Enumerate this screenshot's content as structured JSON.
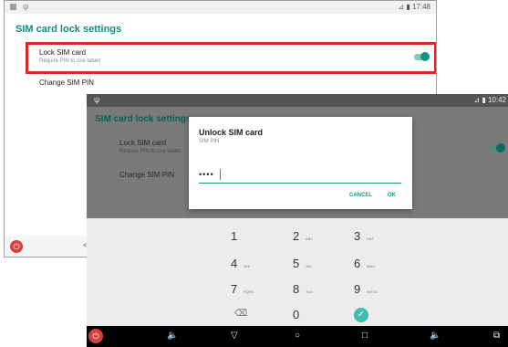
{
  "back_screen": {
    "status": {
      "usb_icon": "usb-icon",
      "time": "17:48",
      "right_icons": "⊿ ▮"
    },
    "title": "SIM card lock settings",
    "lock_sim": {
      "label": "Lock SIM card",
      "summary": "Require PIN to use tablet",
      "toggle_on": true
    },
    "change_pin": "Change SIM PIN",
    "highlight_color": "#e12627",
    "accent": "#0d8f80"
  },
  "front_screen": {
    "status": {
      "time": "10:42",
      "right_icons": "⊿ ▮"
    },
    "title": "SIM card lock settings",
    "lock_sim": {
      "label": "Lock SIM card",
      "summary": "Require PIN to use tablet",
      "toggle_on": true
    },
    "change_pin": "Change SIM PIN",
    "dialog": {
      "title": "Unlock SIM card",
      "subtitle": "SIM PIN",
      "value": "••••",
      "cancel": "CANCEL",
      "ok": "OK"
    },
    "keypad": {
      "k1": "1",
      "k2": "2",
      "k2l": "ABC",
      "k3": "3",
      "k3l": "DEF",
      "k4": "4",
      "k4l": "GHI",
      "k5": "5",
      "k5l": "JKL",
      "k6": "6",
      "k6l": "MNO",
      "k7": "7",
      "k7l": "PQRS",
      "k8": "8",
      "k8l": "TUV",
      "k9": "9",
      "k9l": "WXYZ",
      "backspace": "⌫",
      "k0": "0",
      "k0l": ".",
      "done": "✓"
    },
    "nav": {
      "power": "⏻",
      "volume_down": "🔈",
      "back": "▽",
      "home": "○",
      "recents": "□",
      "volume_up": "🔈",
      "screenshot": "⧉"
    },
    "accent": "#139a8a"
  }
}
